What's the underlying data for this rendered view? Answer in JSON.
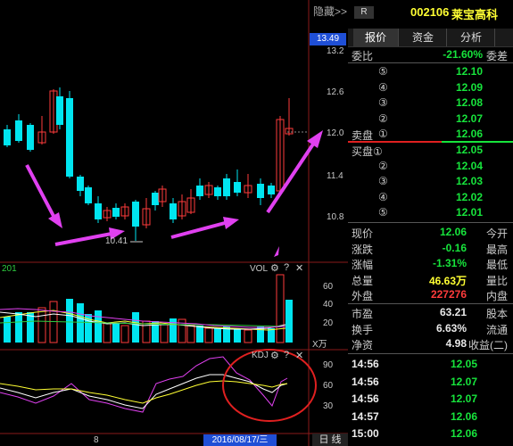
{
  "header": {
    "hide_label": "隐藏>>",
    "r_badge": "R",
    "stock_code": "002106",
    "stock_name": "莱宝高科"
  },
  "tabs": [
    {
      "label": "报价",
      "active": true
    },
    {
      "label": "资金",
      "active": false
    },
    {
      "label": "分析",
      "active": false
    }
  ],
  "price_axis": {
    "current_tag": "13.49",
    "ticks": [
      "13.2",
      "12.6",
      "12.0",
      "11.4",
      "10.8"
    ]
  },
  "vol_panel": {
    "left_label": "201",
    "title": "VOL",
    "ticks": [
      "60",
      "40",
      "20"
    ],
    "unit": "X万"
  },
  "kdj_panel": {
    "title": "KDJ",
    "ticks": [
      "90",
      "60",
      "30"
    ]
  },
  "bottom_bar": {
    "left_label": "8",
    "date": "2016/08/17/三",
    "period": "日 线"
  },
  "chart_annotations": {
    "low_label": "10.41"
  },
  "quote": {
    "weibi_label": "委比",
    "weibi_value": "-21.60%",
    "weicha_label": "委差",
    "sell": [
      {
        "n": "⑤",
        "price": "12.10"
      },
      {
        "n": "④",
        "price": "12.09"
      },
      {
        "n": "③",
        "price": "12.08"
      },
      {
        "n": "②",
        "price": "12.07"
      },
      {
        "n": "①",
        "price": "12.06",
        "label": "卖盘"
      }
    ],
    "buy": [
      {
        "n": "",
        "price": "12.05",
        "label": "买盘①"
      },
      {
        "n": "②",
        "price": "12.04"
      },
      {
        "n": "③",
        "price": "12.03"
      },
      {
        "n": "④",
        "price": "12.02"
      },
      {
        "n": "⑤",
        "price": "12.01"
      }
    ],
    "stats": [
      {
        "label": "现价",
        "value": "12.06",
        "label2": "今开",
        "color": "green"
      },
      {
        "label": "涨跌",
        "value": "-0.16",
        "label2": "最高",
        "color": "green"
      },
      {
        "label": "涨幅",
        "value": "-1.31%",
        "label2": "最低",
        "color": "green"
      },
      {
        "label": "总量",
        "value": "46.63万",
        "label2": "量比",
        "color": "yellow"
      },
      {
        "label": "外盘",
        "value": "227276",
        "label2": "内盘",
        "color": "red"
      }
    ],
    "stats2": [
      {
        "label": "市盈",
        "value": "63.21",
        "label2": "股本",
        "color": "white"
      },
      {
        "label": "换手",
        "value": "6.63%",
        "label2": "流通",
        "color": "white"
      },
      {
        "label": "净资",
        "value": "4.98",
        "label2": "收益(二)",
        "color": "white"
      }
    ],
    "ticks": [
      {
        "time": "14:56",
        "price": "12.05"
      },
      {
        "time": "14:56",
        "price": "12.07"
      },
      {
        "time": "14:56",
        "price": "12.07"
      },
      {
        "time": "14:57",
        "price": "12.06"
      },
      {
        "time": "15:00",
        "price": "12.06"
      }
    ]
  },
  "colors": {
    "up": "#ff3b3b",
    "down": "#00e5f0",
    "magenta": "#e040f0",
    "circle": "#e02020"
  }
}
